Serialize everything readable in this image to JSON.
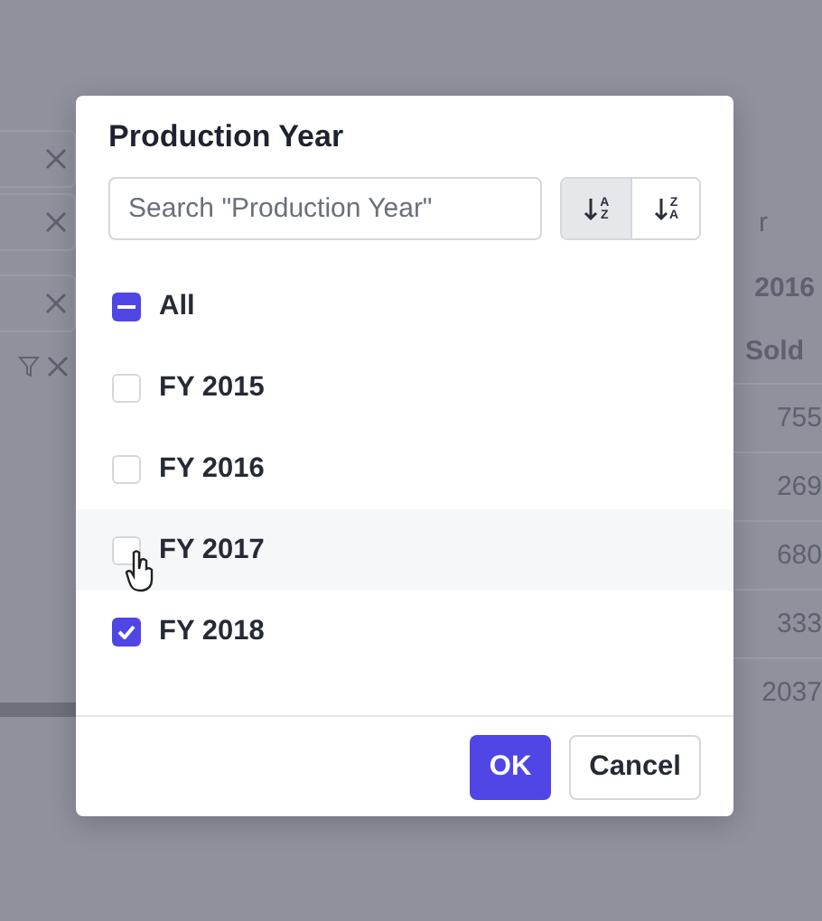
{
  "background": {
    "header_fragments": [
      "r",
      "2016",
      "Sold"
    ],
    "cells": [
      "755",
      "269",
      "680",
      "333",
      "2037"
    ]
  },
  "dialog": {
    "title": "Production Year",
    "search": {
      "placeholder": "Search \"Production Year\""
    },
    "sort_buttons": [
      {
        "letters": [
          "A",
          "Z"
        ],
        "selected": true
      },
      {
        "letters": [
          "Z",
          "A"
        ],
        "selected": false
      }
    ],
    "select_all": {
      "label": "All",
      "indeterminate": true
    },
    "options": [
      {
        "label": "FY 2015",
        "checked": false,
        "hovered": false
      },
      {
        "label": "FY 2016",
        "checked": false,
        "hovered": false
      },
      {
        "label": "FY 2017",
        "checked": false,
        "hovered": true
      },
      {
        "label": "FY 2018",
        "checked": true,
        "hovered": false
      }
    ],
    "buttons": [
      {
        "label": "OK",
        "kind": "primary"
      },
      {
        "label": "Cancel",
        "kind": "secondary"
      }
    ]
  }
}
